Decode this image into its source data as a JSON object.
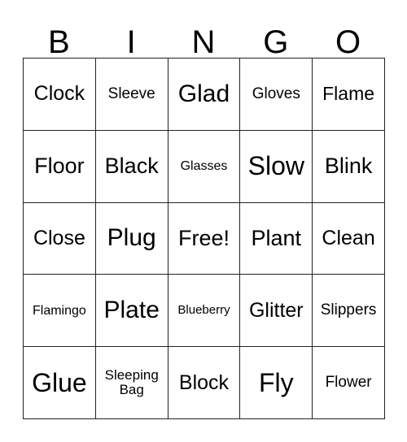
{
  "card": {
    "header_letters": [
      "B",
      "I",
      "N",
      "G",
      "O"
    ],
    "rows": [
      [
        {
          "text": "Clock",
          "size": "fs-m"
        },
        {
          "text": "Sleeve",
          "size": "fs-xs"
        },
        {
          "text": "Glad",
          "size": "fs-xl"
        },
        {
          "text": "Gloves",
          "size": "fs-xs"
        },
        {
          "text": "Flame",
          "size": "fs-s"
        }
      ],
      [
        {
          "text": "Floor",
          "size": "fs-l"
        },
        {
          "text": "Black",
          "size": "fs-l"
        },
        {
          "text": "Glasses",
          "size": "fs-t"
        },
        {
          "text": "Slow",
          "size": "fs-xxl"
        },
        {
          "text": "Blink",
          "size": "fs-l"
        }
      ],
      [
        {
          "text": "Close",
          "size": "fs-m"
        },
        {
          "text": "Plug",
          "size": "fs-xl"
        },
        {
          "text": "Free!",
          "size": "fs-l"
        },
        {
          "text": "Plant",
          "size": "fs-l"
        },
        {
          "text": "Clean",
          "size": "fs-m"
        }
      ],
      [
        {
          "text": "Flamingo",
          "size": "fs-t"
        },
        {
          "text": "Plate",
          "size": "fs-xl"
        },
        {
          "text": "Blueberry",
          "size": "fs-tt"
        },
        {
          "text": "Glitter",
          "size": "fs-m"
        },
        {
          "text": "Slippers",
          "size": "fs-xs"
        }
      ],
      [
        {
          "text": "Glue",
          "size": "fs-xxl"
        },
        {
          "text": "Sleeping\nBag",
          "size": "fs-xxs"
        },
        {
          "text": "Block",
          "size": "fs-m"
        },
        {
          "text": "Fly",
          "size": "fs-xxl"
        },
        {
          "text": "Flower",
          "size": "fs-xs"
        }
      ]
    ]
  }
}
